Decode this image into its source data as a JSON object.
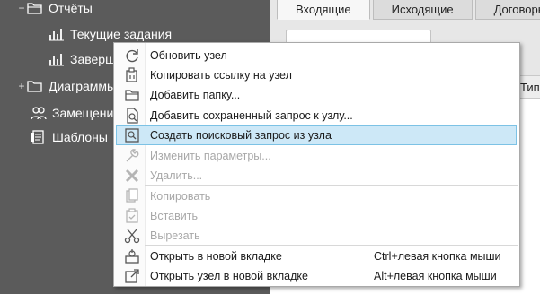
{
  "tree": {
    "items": [
      {
        "toggle": "−",
        "label": "Отчёты",
        "icon": "folder-open-icon"
      },
      {
        "toggle": "",
        "label": "Текущие задания",
        "icon": "report-chart-icon"
      },
      {
        "toggle": "",
        "label": "Заверш",
        "icon": "report-chart-icon"
      },
      {
        "toggle": "+",
        "label": "Диаграммы",
        "icon": "folder-icon"
      },
      {
        "toggle": "",
        "label": "Замещени",
        "icon": "users-icon"
      },
      {
        "toggle": "",
        "label": "Шаблоны",
        "icon": "template-icon"
      }
    ]
  },
  "tabs": [
    "Входящие",
    "Исходящие",
    "Договоры"
  ],
  "grid": {
    "column_header": "Тип"
  },
  "menu": {
    "items": [
      {
        "label": "Обновить узел",
        "icon": "refresh-icon",
        "shortcut": "",
        "enabled": true
      },
      {
        "label": "Копировать ссылку на узел",
        "icon": "copy-link-icon",
        "shortcut": "",
        "enabled": true
      },
      {
        "label": "Добавить папку...",
        "icon": "add-folder-icon",
        "shortcut": "",
        "enabled": true
      },
      {
        "label": "Добавить сохраненный запрос к узлу...",
        "icon": "saved-query-icon",
        "shortcut": "",
        "enabled": true
      },
      {
        "label": "Создать поисковый запрос из узла",
        "icon": "search-query-icon",
        "shortcut": "",
        "enabled": true,
        "highlighted": true
      },
      {
        "label": "Изменить параметры...",
        "icon": "wrench-icon",
        "shortcut": "",
        "enabled": false
      },
      {
        "label": "Удалить...",
        "icon": "delete-icon",
        "shortcut": "",
        "enabled": false
      },
      {
        "label": "Копировать",
        "icon": "copy-icon",
        "shortcut": "",
        "enabled": false
      },
      {
        "label": "Вставить",
        "icon": "paste-icon",
        "shortcut": "",
        "enabled": false
      },
      {
        "label": "Вырезать",
        "icon": "cut-icon",
        "shortcut": "",
        "enabled": false
      },
      {
        "label": "Открыть в новой вкладке",
        "icon": "open-new-tab-icon",
        "shortcut": "Ctrl+левая кнопка мыши",
        "enabled": true
      },
      {
        "label": "Открыть узел в новой вкладке",
        "icon": "open-external-icon",
        "shortcut": "Alt+левая кнопка мыши",
        "enabled": true
      }
    ]
  }
}
